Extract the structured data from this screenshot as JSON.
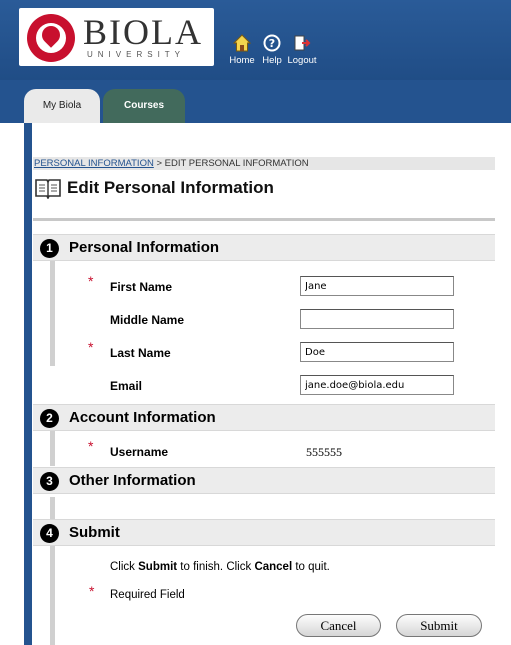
{
  "header": {
    "logo_word": "BIOLA",
    "logo_sub": "UNIVERSITY",
    "nav": [
      {
        "label": "Home",
        "icon": "home-icon"
      },
      {
        "label": "Help",
        "icon": "help-icon"
      },
      {
        "label": "Logout",
        "icon": "logout-icon"
      }
    ]
  },
  "tabs": [
    {
      "label": "My Biola"
    },
    {
      "label": "Courses"
    }
  ],
  "breadcrumb": {
    "link": "PERSONAL INFORMATION",
    "separator": ">",
    "current": "EDIT PERSONAL INFORMATION"
  },
  "page_title": "Edit Personal Information",
  "sections": [
    {
      "num": "1",
      "title": "Personal Information"
    },
    {
      "num": "2",
      "title": "Account Information"
    },
    {
      "num": "3",
      "title": "Other Information"
    },
    {
      "num": "4",
      "title": "Submit"
    }
  ],
  "personal_fields": [
    {
      "label": "First Name",
      "value": "Jane",
      "required": true
    },
    {
      "label": "Middle Name",
      "value": "",
      "required": false
    },
    {
      "label": "Last Name",
      "value": "Doe",
      "required": true
    },
    {
      "label": "Email",
      "value": "jane.doe@biola.edu",
      "required": false
    }
  ],
  "account_fields": [
    {
      "label": "Username",
      "value": "555555",
      "required": true
    }
  ],
  "submit": {
    "text_1": "Click ",
    "text_submit": "Submit",
    "text_2": " to finish. Click ",
    "text_cancel": "Cancel",
    "text_3": " to quit.",
    "required_note": "Required Field",
    "required_marker": "*",
    "cancel_label": "Cancel",
    "submit_label": "Submit"
  },
  "colors": {
    "header_blue": "#24538f",
    "courses_tab_green": "#426a5c",
    "required_red": "#c8102e"
  }
}
